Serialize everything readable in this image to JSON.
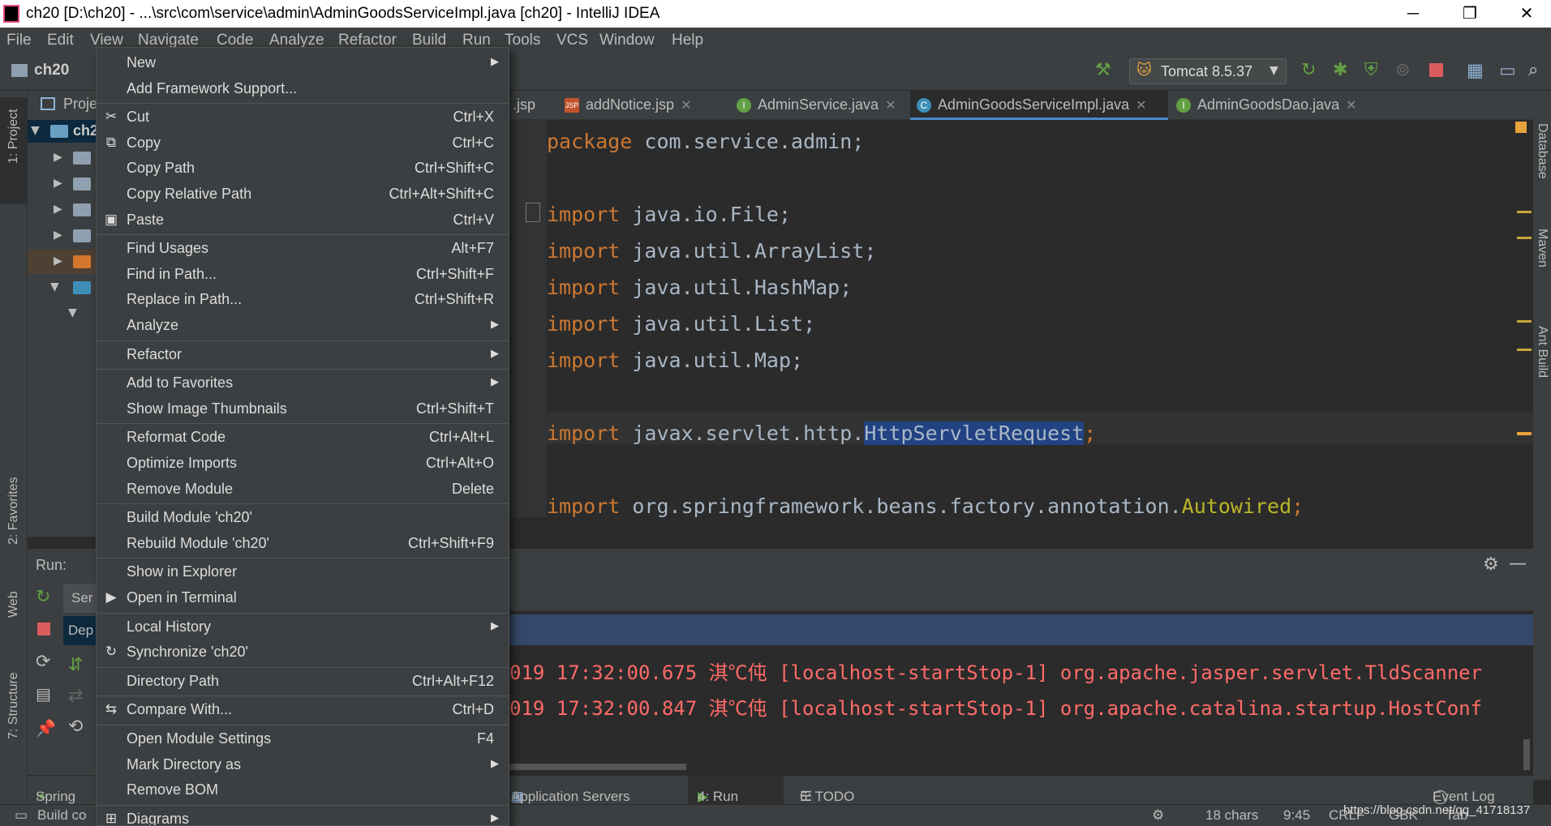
{
  "window": {
    "title": "ch20 [D:\\ch20] - ...\\src\\com\\service\\admin\\AdminGoodsServiceImpl.java [ch20] - IntelliJ IDEA",
    "minimize": "─",
    "maximize": "❐",
    "close": "✕"
  },
  "menubar": [
    "File",
    "Edit",
    "View",
    "Navigate",
    "Code",
    "Analyze",
    "Refactor",
    "Build",
    "Run",
    "Tools",
    "VCS",
    "Window",
    "Help"
  ],
  "navbar": {
    "project": "ch20",
    "run_config": "Tomcat 8.5.37"
  },
  "left_strip": {
    "project": "1: Project",
    "favorites": "2: Favorites",
    "web": "Web",
    "structure": "7: Structure"
  },
  "right_strip": {
    "database": "Database",
    "maven": "Maven",
    "ant": "Ant Build"
  },
  "project_panel": {
    "header": "Proje",
    "root": "ch2"
  },
  "tabs": [
    {
      "label": ".jsp"
    },
    {
      "label": "addNotice.jsp"
    },
    {
      "label": "AdminService.java"
    },
    {
      "label": "AdminGoodsServiceImpl.java"
    },
    {
      "label": "AdminGoodsDao.java"
    }
  ],
  "code": {
    "line1_kw": "package",
    "line1_rest": " com.service.admin;",
    "imports": [
      " java.io.File;",
      " java.util.ArrayList;",
      " java.util.HashMap;",
      " java.util.List;",
      " java.util.Map;"
    ],
    "import_kw": "import",
    "servlet_pre": " javax.servlet.http.",
    "servlet_cls": "HttpServletRequest",
    "servlet_end": ";",
    "spring_pre": " org.springframework.beans.factory.annotation.",
    "spring_cls": "Autowired",
    "spring_end": ";"
  },
  "run_panel": {
    "label": "Run:",
    "tree_item1": "Ser",
    "tree_item2": "Dep"
  },
  "console": {
    "line1": "019 17:32:00.675 淇℃伅 [localhost-startStop-1] org.apache.jasper.servlet.TldScanner",
    "line2": "019 17:32:00.847 淇℃伅 [localhost-startStop-1] org.apache.catalina.startup.HostConf"
  },
  "bottom_tabs": {
    "spring": "Spring",
    "app_servers": "Application Servers",
    "run": "4: Run",
    "todo": "6: TODO",
    "event_log": "Event Log"
  },
  "status": {
    "build": "Build co",
    "chars": "18 chars",
    "pos": "9:45",
    "crlf": "CRLF",
    "enc": "GBK",
    "tab": "Tab",
    "watermark": "https://blog.csdn.net/qq_41718137"
  },
  "context_menu": [
    {
      "label": "New",
      "shortcut": "",
      "submenu": true,
      "icon": ""
    },
    {
      "label": "Add Framework Support...",
      "shortcut": "",
      "submenu": false,
      "icon": "",
      "sep_after": true
    },
    {
      "label": "Cut",
      "shortcut": "Ctrl+X",
      "submenu": false,
      "icon": "✂"
    },
    {
      "label": "Copy",
      "shortcut": "Ctrl+C",
      "submenu": false,
      "icon": "⧉"
    },
    {
      "label": "Copy Path",
      "shortcut": "Ctrl+Shift+C",
      "submenu": false,
      "icon": ""
    },
    {
      "label": "Copy Relative Path",
      "shortcut": "Ctrl+Alt+Shift+C",
      "submenu": false,
      "icon": ""
    },
    {
      "label": "Paste",
      "shortcut": "Ctrl+V",
      "submenu": false,
      "icon": "▣",
      "sep_after": true
    },
    {
      "label": "Find Usages",
      "shortcut": "Alt+F7",
      "submenu": false,
      "icon": ""
    },
    {
      "label": "Find in Path...",
      "shortcut": "Ctrl+Shift+F",
      "submenu": false,
      "icon": ""
    },
    {
      "label": "Replace in Path...",
      "shortcut": "Ctrl+Shift+R",
      "submenu": false,
      "icon": ""
    },
    {
      "label": "Analyze",
      "shortcut": "",
      "submenu": true,
      "icon": "",
      "sep_after": true
    },
    {
      "label": "Refactor",
      "shortcut": "",
      "submenu": true,
      "icon": "",
      "sep_after": true
    },
    {
      "label": "Add to Favorites",
      "shortcut": "",
      "submenu": true,
      "icon": ""
    },
    {
      "label": "Show Image Thumbnails",
      "shortcut": "Ctrl+Shift+T",
      "submenu": false,
      "icon": "",
      "sep_after": true
    },
    {
      "label": "Reformat Code",
      "shortcut": "Ctrl+Alt+L",
      "submenu": false,
      "icon": ""
    },
    {
      "label": "Optimize Imports",
      "shortcut": "Ctrl+Alt+O",
      "submenu": false,
      "icon": ""
    },
    {
      "label": "Remove Module",
      "shortcut": "Delete",
      "submenu": false,
      "icon": "",
      "sep_after": true
    },
    {
      "label": "Build Module 'ch20'",
      "shortcut": "",
      "submenu": false,
      "icon": ""
    },
    {
      "label": "Rebuild Module 'ch20'",
      "shortcut": "Ctrl+Shift+F9",
      "submenu": false,
      "icon": "",
      "sep_after": true
    },
    {
      "label": "Show in Explorer",
      "shortcut": "",
      "submenu": false,
      "icon": ""
    },
    {
      "label": "Open in Terminal",
      "shortcut": "",
      "submenu": false,
      "icon": "▶",
      "sep_after": true
    },
    {
      "label": "Local History",
      "shortcut": "",
      "submenu": true,
      "icon": ""
    },
    {
      "label": "Synchronize 'ch20'",
      "shortcut": "",
      "submenu": false,
      "icon": "↻",
      "sep_after": true
    },
    {
      "label": "Directory Path",
      "shortcut": "Ctrl+Alt+F12",
      "submenu": false,
      "icon": "",
      "sep_after": true
    },
    {
      "label": "Compare With...",
      "shortcut": "Ctrl+D",
      "submenu": false,
      "icon": "⇆",
      "sep_after": true
    },
    {
      "label": "Open Module Settings",
      "shortcut": "F4",
      "submenu": false,
      "icon": ""
    },
    {
      "label": "Mark Directory as",
      "shortcut": "",
      "submenu": true,
      "icon": ""
    },
    {
      "label": "Remove BOM",
      "shortcut": "",
      "submenu": false,
      "icon": "",
      "sep_after": true
    },
    {
      "label": "Diagrams",
      "shortcut": "",
      "submenu": true,
      "icon": "⊞"
    }
  ],
  "colors": {
    "bg": "#2b2b2b",
    "panel": "#3c3f41",
    "keyword": "#cc7832",
    "selection": "#214283",
    "error_log": "#ff6b68"
  }
}
